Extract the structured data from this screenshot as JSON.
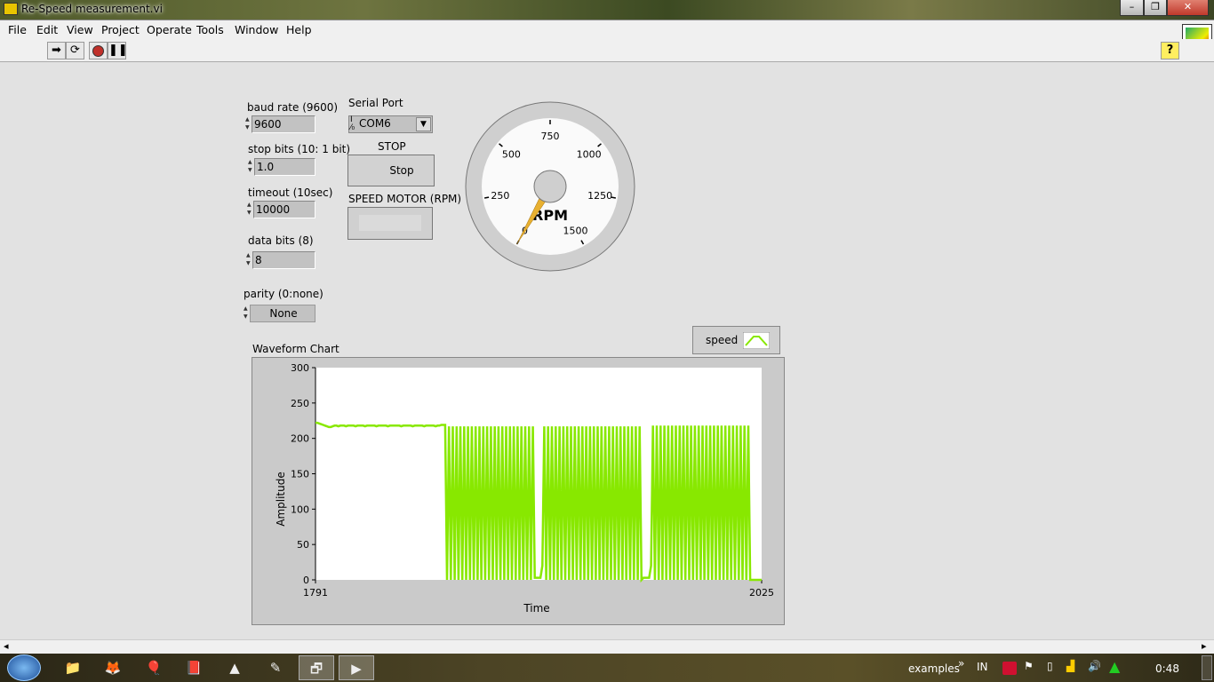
{
  "window": {
    "title": "Re-Speed measurement.vi"
  },
  "menu": [
    "File",
    "Edit",
    "View",
    "Project",
    "Operate",
    "Tools",
    "Window",
    "Help"
  ],
  "toolbar": {
    "run": "run-arrow-icon",
    "run_continuously": "run-continuously-icon",
    "abort": "abort-icon",
    "pause": "pause-icon",
    "help": "?"
  },
  "controls": {
    "baud_rate": {
      "label": "baud rate (9600)",
      "value": "9600"
    },
    "stop_bits": {
      "label": "stop bits (10: 1 bit)",
      "value": "1.0"
    },
    "timeout": {
      "label": "timeout (10sec)",
      "value": "10000"
    },
    "data_bits": {
      "label": "data bits (8)",
      "value": "8"
    },
    "parity": {
      "label": "parity (0:none)",
      "value": "None"
    },
    "serial_port": {
      "label": "Serial Port",
      "value": "COM6"
    },
    "stop": {
      "label": "STOP",
      "button": "Stop"
    },
    "speed_motor": {
      "label": "SPEED MOTOR (RPM)",
      "value": ""
    }
  },
  "gauge": {
    "unit": "RPM",
    "ticks": [
      "0",
      "250",
      "500",
      "750",
      "1000",
      "1250",
      "1500"
    ],
    "min": 0,
    "max": 1500,
    "value": 0,
    "needle_color": "#e8b030"
  },
  "chart_data": {
    "type": "line",
    "title": "Waveform Chart",
    "xlabel": "Time",
    "ylabel": "Amplitude",
    "xlim": [
      1791,
      2025
    ],
    "ylim": [
      0,
      300
    ],
    "yticks": [
      "0",
      "50",
      "100",
      "150",
      "200",
      "250",
      "300"
    ],
    "xticks": [
      "1791",
      "2025"
    ],
    "grid": false,
    "legend": "top-right",
    "series": [
      {
        "name": "speed",
        "color": "#88e800",
        "x_start": 1791,
        "values": [
          222,
          222,
          221,
          220,
          219,
          218,
          217,
          216,
          216,
          217,
          218,
          218,
          217,
          218,
          218,
          218,
          217,
          218,
          218,
          218,
          218,
          217,
          218,
          218,
          218,
          218,
          217,
          218,
          218,
          218,
          218,
          218,
          217,
          218,
          218,
          218,
          218,
          218,
          217,
          218,
          218,
          218,
          218,
          218,
          218,
          217,
          218,
          218,
          218,
          218,
          218,
          217,
          218,
          218,
          218,
          218,
          218,
          217,
          218,
          218,
          218,
          218,
          218,
          217,
          218,
          218,
          219,
          219,
          219,
          0,
          217,
          0,
          217,
          0,
          217,
          0,
          217,
          0,
          217,
          0,
          217,
          0,
          217,
          0,
          217,
          0,
          217,
          0,
          217,
          0,
          217,
          0,
          217,
          0,
          217,
          0,
          217,
          0,
          217,
          0,
          217,
          0,
          217,
          0,
          217,
          0,
          217,
          0,
          217,
          0,
          217,
          0,
          217,
          0,
          217,
          3,
          3,
          3,
          3,
          20,
          217,
          0,
          217,
          0,
          217,
          0,
          217,
          0,
          217,
          0,
          217,
          0,
          217,
          0,
          217,
          0,
          217,
          0,
          217,
          0,
          217,
          0,
          217,
          0,
          217,
          0,
          217,
          0,
          217,
          0,
          217,
          0,
          217,
          0,
          217,
          0,
          217,
          0,
          217,
          0,
          217,
          0,
          217,
          0,
          217,
          0,
          217,
          0,
          217,
          0,
          217,
          0,
          3,
          3,
          3,
          3,
          20,
          218,
          0,
          218,
          0,
          218,
          0,
          218,
          0,
          218,
          0,
          218,
          0,
          218,
          0,
          218,
          0,
          218,
          0,
          218,
          0,
          218,
          0,
          218,
          0,
          218,
          0,
          218,
          0,
          218,
          0,
          218,
          0,
          218,
          0,
          218,
          0,
          218,
          0,
          218,
          0,
          218,
          0,
          218,
          0,
          218,
          0,
          218,
          0,
          218,
          0,
          218,
          0,
          0,
          0,
          0,
          0,
          0,
          0
        ]
      }
    ]
  },
  "hscroll": {
    "left": "◂",
    "right": "▸"
  },
  "taskbar": {
    "toolbar_label": "examples",
    "chevron": "»",
    "language": "IN",
    "clock": "0:48"
  }
}
